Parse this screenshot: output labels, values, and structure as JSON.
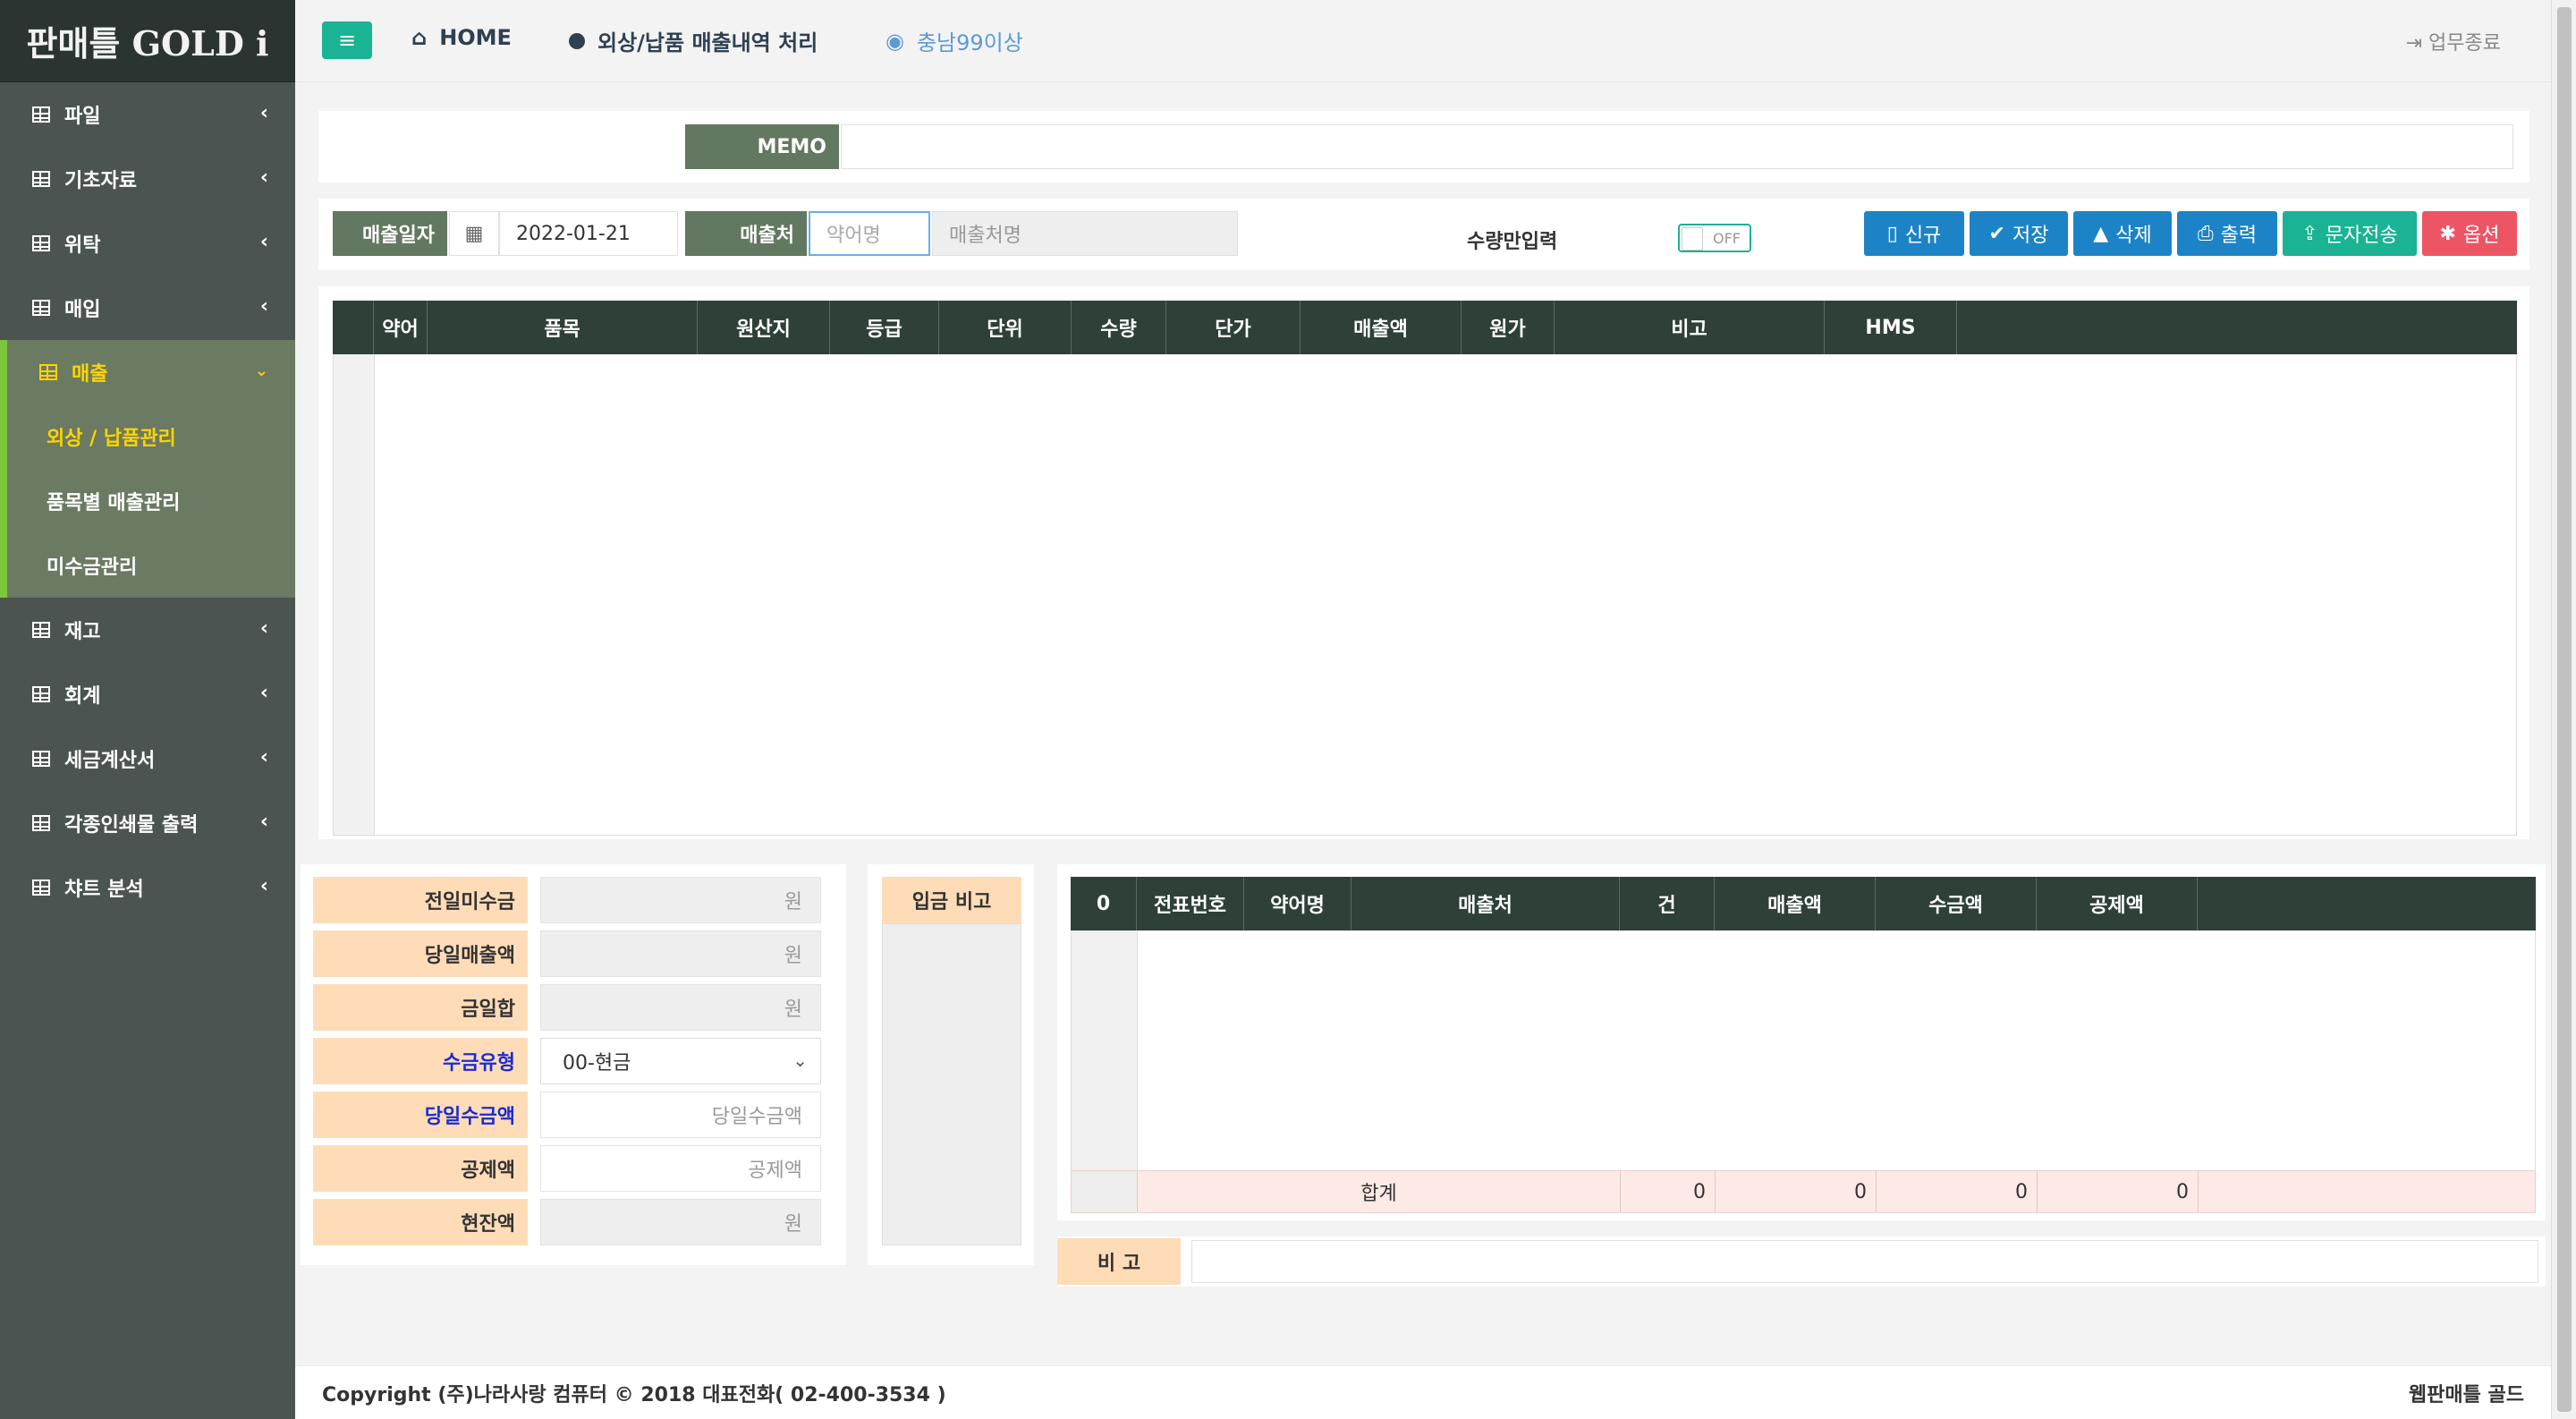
{
  "app": {
    "logo": "판매틀 GOLD i"
  },
  "sidebar": {
    "items": [
      {
        "label": "파일"
      },
      {
        "label": "기초자료"
      },
      {
        "label": "위탁"
      },
      {
        "label": "매입"
      },
      {
        "label": "매출"
      },
      {
        "label": "재고"
      },
      {
        "label": "회계"
      },
      {
        "label": "세금계산서"
      },
      {
        "label": "각종인쇄물 출력"
      },
      {
        "label": "챠트 분석"
      }
    ],
    "sub_items": [
      {
        "label": "외상 / 납품관리"
      },
      {
        "label": "품목별 매출관리"
      },
      {
        "label": "미수금관리"
      }
    ]
  },
  "header": {
    "home": "HOME",
    "page": "외상/납품 매출내역 처리",
    "user": "충남99이상",
    "logout": "업무종료"
  },
  "memo": {
    "label": "MEMO",
    "value": ""
  },
  "form": {
    "date_label": "매출일자",
    "date_value": "2022-01-21",
    "customer_label": "매출처",
    "abbr_placeholder": "약어명",
    "customer_placeholder": "매출처명",
    "qty_only_label": "수량만입력",
    "toggle_state": "OFF"
  },
  "toolbar": {
    "new": "신규",
    "save": "저장",
    "delete": "삭제",
    "print": "출력",
    "sms": "문자전송",
    "options": "옵션"
  },
  "items_grid": {
    "columns": [
      "약어",
      "품목",
      "원산지",
      "등급",
      "단위",
      "수량",
      "단가",
      "매출액",
      "원가",
      "비고",
      "HMS"
    ]
  },
  "summary": {
    "prev_unpaid": {
      "label": "전일미수금",
      "placeholder": "원"
    },
    "today_sales": {
      "label": "당일매출액",
      "placeholder": "원"
    },
    "total": {
      "label": "금일합",
      "placeholder": "원"
    },
    "payment_type": {
      "label": "수금유형",
      "value": "00-현금"
    },
    "today_collected": {
      "label": "당일수금액",
      "placeholder": "당일수금액"
    },
    "deduction": {
      "label": "공제액",
      "placeholder": "공제액"
    },
    "balance": {
      "label": "현잔액",
      "placeholder": "원"
    }
  },
  "deposit_note": {
    "label": "입금 비고"
  },
  "slips_grid": {
    "count": "0",
    "columns": [
      "전표번호",
      "약어명",
      "매출처",
      "건",
      "매출액",
      "수금액",
      "공제액"
    ],
    "total_label": "합계",
    "totals": [
      "0",
      "0",
      "0",
      "0"
    ]
  },
  "remark": {
    "label": "비 고"
  },
  "footer": {
    "copyright": "Copyright (주)나라사랑 컴퓨터 © 2018 대표전화( 02-400-3534 )",
    "brand": "웹판매틀 골드"
  }
}
